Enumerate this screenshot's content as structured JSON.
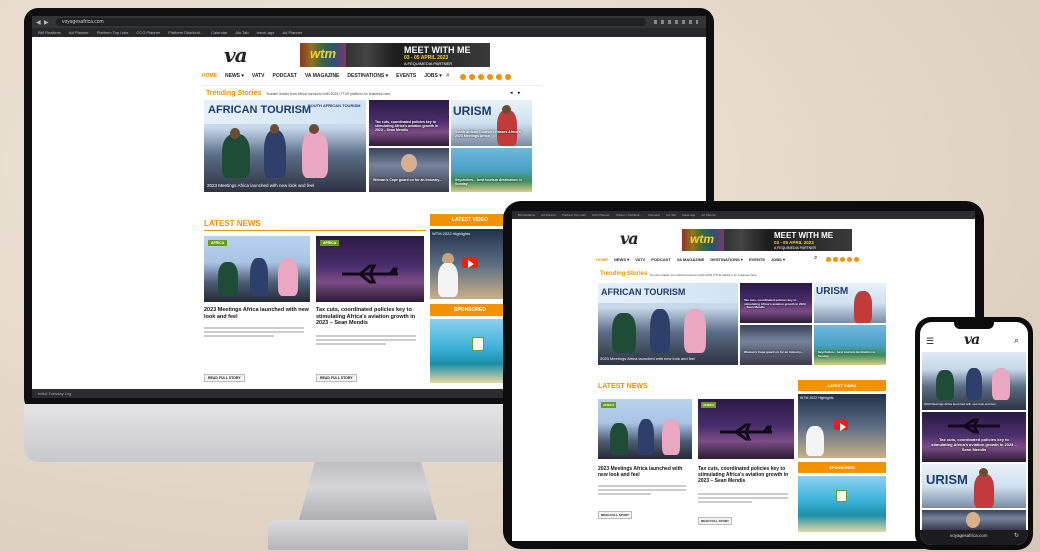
{
  "site": {
    "logo": "va",
    "banner": {
      "brand": "wtm",
      "headline": "MEET WITH ME",
      "dates": "03 - 05 APRIL 2023",
      "partner": "A FEQUIMEDIA PARTNER"
    },
    "nav": [
      "HOME",
      "NEWS ▾",
      "VATV",
      "PODCAST",
      "VA MAGAZINE",
      "DESTINATIONS ▾",
      "EVENTS",
      "JOBS ▾"
    ],
    "trending": {
      "label": "Trending Stories",
      "ticker": "Tourism leader from Africa honoured with 2023 ITTLR platform for business here"
    },
    "hero": {
      "main_banner": "AFRICAN TOURISM",
      "main_banner_right": "SOUTH AFRICAN TOURISM",
      "main_caption": "2023 Meetings Africa launched with new look and feel",
      "tile_plane": "Tax cuts, coordinated policies key to stimulating Africa's aviation growth in 2023 – Sean Mendis",
      "tile_tourism": "South African Tourism releases Africa's 2023 Meetings Africa",
      "tile_woman": "Woman's Cape guard on for an industry...",
      "tile_beach": "Seychelles... best tourism destination in Sunday",
      "tile_word": "URISM"
    },
    "latest_news": {
      "title": "LATEST NEWS",
      "articles": [
        {
          "tag": "AFRICA",
          "title": "2023 Meetings Africa launched with new look and feel",
          "read": "READ FULL STORY"
        },
        {
          "tag": "AFRICA",
          "title": "Tax cuts, coordinated policies key to stimulating Africa's aviation growth in 2023 – Sean Mendis",
          "read": "READ FULL STORY"
        }
      ]
    },
    "sidebar": {
      "latest_video": "LATEST VIDEO",
      "video_title": "WTM 2022 Highlights",
      "sponsored": "SPONSORED"
    }
  },
  "browser": {
    "url": "voyagesafrica.com",
    "bookmarks": [
      "BM Realtime",
      "Ad Planner",
      "Platform Top Lists",
      "CCO Planner",
      "Platform Distributi...",
      "Calendar",
      "Alo Tab",
      "travel-age",
      "Ad Planner"
    ],
    "status": "Initial Tuesday Log"
  },
  "phone": {
    "plane_caption": "Tax cuts, coordinated policies key to stimulating Africa's aviation growth in 2023 – Sean Mendis",
    "url": "voyagesafrica.com"
  }
}
